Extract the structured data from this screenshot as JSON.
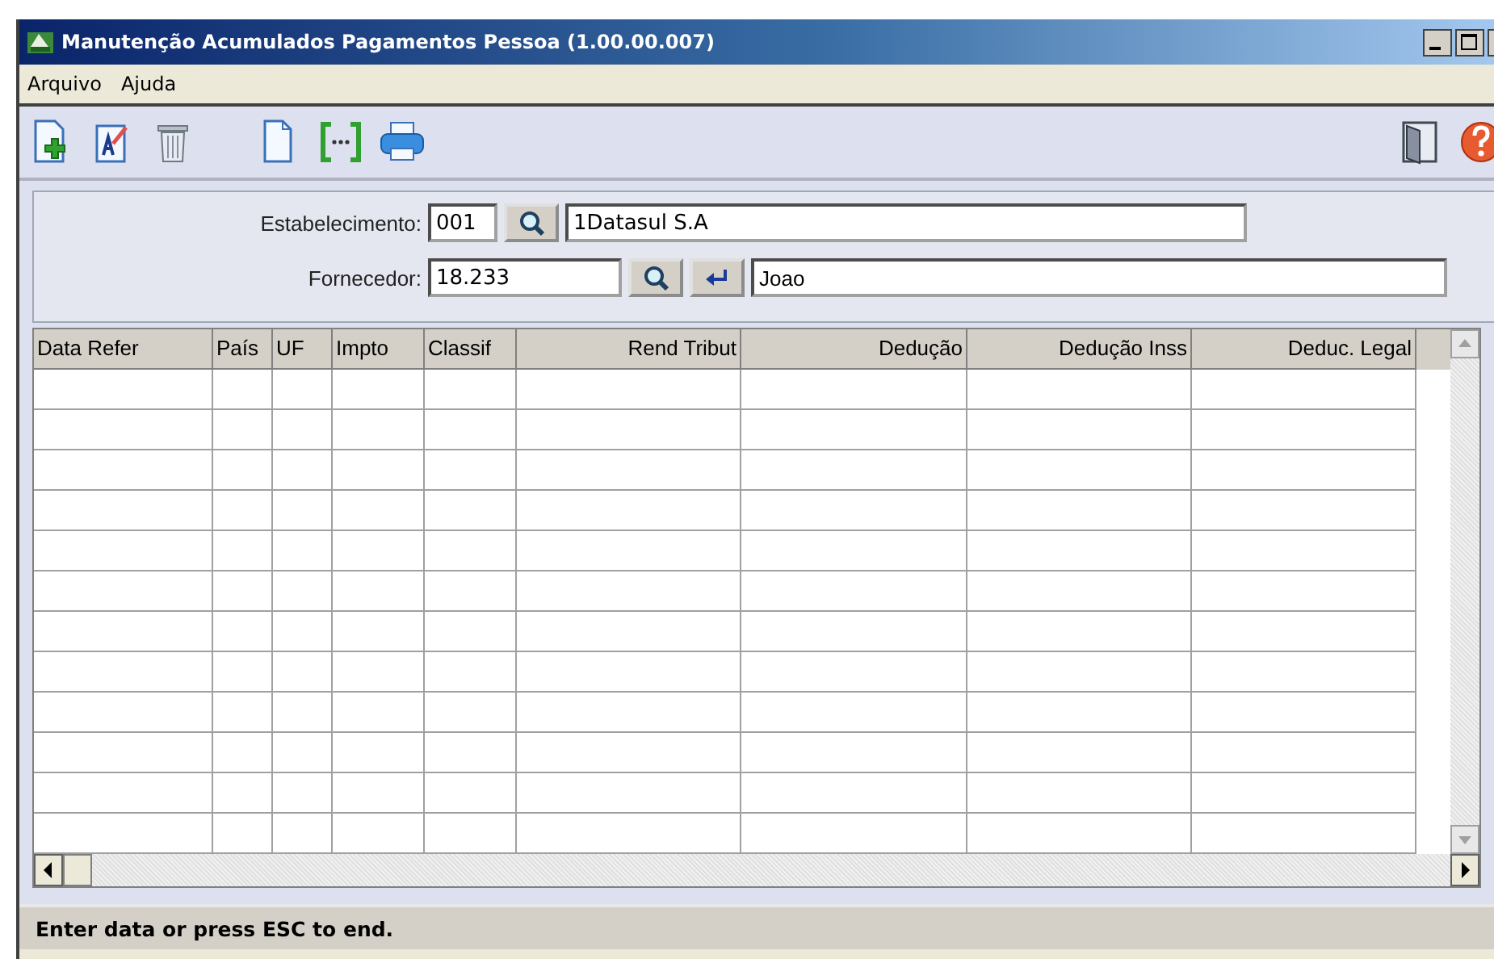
{
  "window": {
    "title": "Manutenção Acumulados Pagamentos Pessoa (1.00.00.007)"
  },
  "menu": [
    {
      "label": "Arquivo"
    },
    {
      "label": "Ajuda"
    }
  ],
  "toolbar": [
    {
      "kind": "new"
    },
    {
      "kind": "edit"
    },
    {
      "kind": "delete"
    },
    {
      "kind": "gap"
    },
    {
      "kind": "document"
    },
    {
      "kind": "brackets"
    },
    {
      "kind": "print"
    }
  ],
  "toolbar_right": [
    {
      "kind": "exit"
    },
    {
      "kind": "help"
    }
  ],
  "form": {
    "fields": [
      {
        "label": "Estabelecimento:",
        "code": "001",
        "description": "1Datasul S.A",
        "buttons": [
          {
            "kind": "search"
          }
        ]
      },
      {
        "label": "Fornecedor:",
        "code": "18.233",
        "description": "Joao",
        "buttons": [
          {
            "kind": "search"
          },
          {
            "kind": "enter"
          }
        ]
      }
    ]
  },
  "table": {
    "columns": [
      {
        "label": "Data Refer",
        "kind": "text"
      },
      {
        "label": "País",
        "kind": "text"
      },
      {
        "label": "UF",
        "kind": "text"
      },
      {
        "label": "Impto",
        "kind": "text"
      },
      {
        "label": "Classif",
        "kind": "text"
      },
      {
        "label": "Rend Tribut",
        "kind": "number"
      },
      {
        "label": "Dedução",
        "kind": "number"
      },
      {
        "label": "Dedução Inss",
        "kind": "number"
      },
      {
        "label": "Deduc. Legal",
        "kind": "number"
      }
    ]
  },
  "status_bar": "Enter data or press ESC to end."
}
